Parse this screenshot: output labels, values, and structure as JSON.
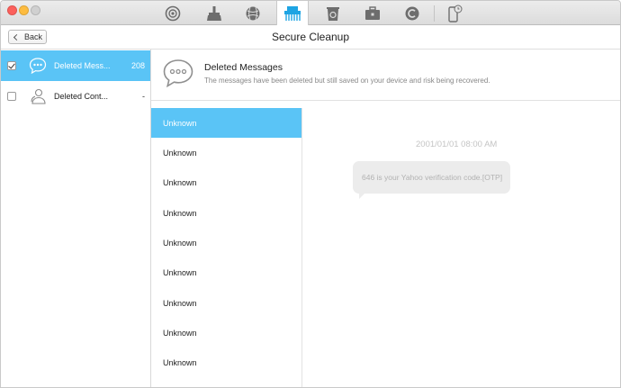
{
  "toolbar": {
    "tabs": [
      {
        "icon": "airbackup-icon"
      },
      {
        "icon": "cleanup-brush-icon"
      },
      {
        "icon": "network-sphere-icon"
      },
      {
        "icon": "secure-cleanup-shredder-icon",
        "active": true
      },
      {
        "icon": "recycle-bin-icon"
      },
      {
        "icon": "toolkit-briefcase-icon"
      },
      {
        "icon": "copyright-c-icon"
      },
      {
        "icon": "device-phone-icon"
      }
    ]
  },
  "header": {
    "back_label": "Back",
    "title": "Secure Cleanup"
  },
  "sidebar": {
    "items": [
      {
        "label": "Deleted Mess...",
        "count": "208",
        "checked": true,
        "selected": true,
        "icon": "message-bubble-icon"
      },
      {
        "label": "Deleted Cont...",
        "count": "-",
        "checked": false,
        "selected": false,
        "icon": "contacts-person-icon"
      }
    ]
  },
  "info": {
    "title": "Deleted Messages",
    "description": "The messages have been deleted but still saved on your device and risk being recovered."
  },
  "messages": {
    "items": [
      "Unknown",
      "Unknown",
      "Unknown",
      "Unknown",
      "Unknown",
      "Unknown",
      "Unknown",
      "Unknown",
      "Unknown"
    ]
  },
  "conversation": {
    "timestamp": "2001/01/01 08:00 AM",
    "bubble_text": "646 is your Yahoo verification code.[OTP]"
  },
  "colors": {
    "accent": "#5ac4f6"
  }
}
